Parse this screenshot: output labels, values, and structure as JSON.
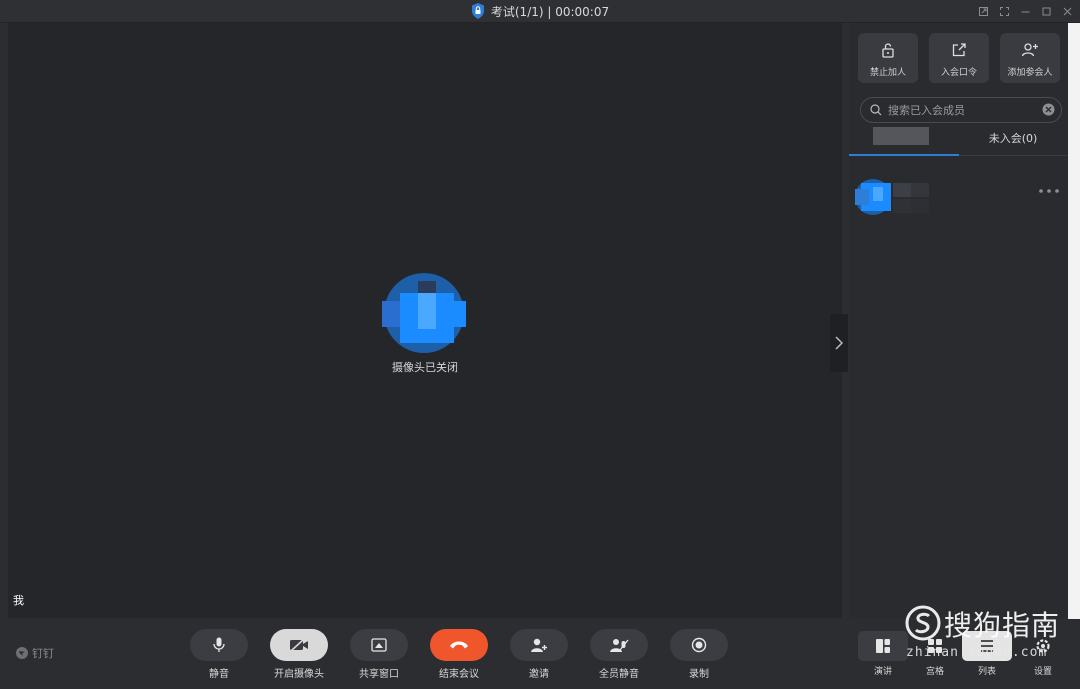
{
  "titlebar": {
    "title": "考试(1/1) | 00:00:07"
  },
  "video": {
    "camera_status": "摄像头已关闭",
    "self_label": "我"
  },
  "sidepanel": {
    "actions": [
      {
        "label": "禁止加人",
        "icon": "unlock-icon"
      },
      {
        "label": "入会口令",
        "icon": "share-out-icon"
      },
      {
        "label": "添加参会人",
        "icon": "add-person-icon"
      }
    ],
    "search": {
      "placeholder": "搜索已入会成员",
      "value": ""
    },
    "tabs": {
      "not_joined": "未入会(0)"
    }
  },
  "toolbar": {
    "brand": "钉钉",
    "buttons": [
      {
        "label": "静音",
        "icon": "microphone-icon"
      },
      {
        "label": "开启摄像头",
        "icon": "camera-off-icon"
      },
      {
        "label": "共享窗口",
        "icon": "share-window-icon"
      },
      {
        "label": "结束会议",
        "icon": "hang-up-icon"
      },
      {
        "label": "邀请",
        "icon": "invite-icon"
      },
      {
        "label": "全员静音",
        "icon": "mute-all-icon"
      },
      {
        "label": "录制",
        "icon": "record-icon"
      }
    ],
    "right_buttons": [
      {
        "label": "演讲",
        "icon": "speaker-layout-icon"
      },
      {
        "label": "宫格",
        "icon": "grid-layout-icon"
      },
      {
        "label": "列表",
        "icon": "list-icon"
      },
      {
        "label": "设置",
        "icon": "settings-icon"
      }
    ]
  },
  "watermark": {
    "text": "搜狗指南",
    "url": "zhinan.sogou.com"
  },
  "colors": {
    "end_call": "#f0562c",
    "accent": "#2e7dd7",
    "avatar_blue": "#1a8cff"
  }
}
